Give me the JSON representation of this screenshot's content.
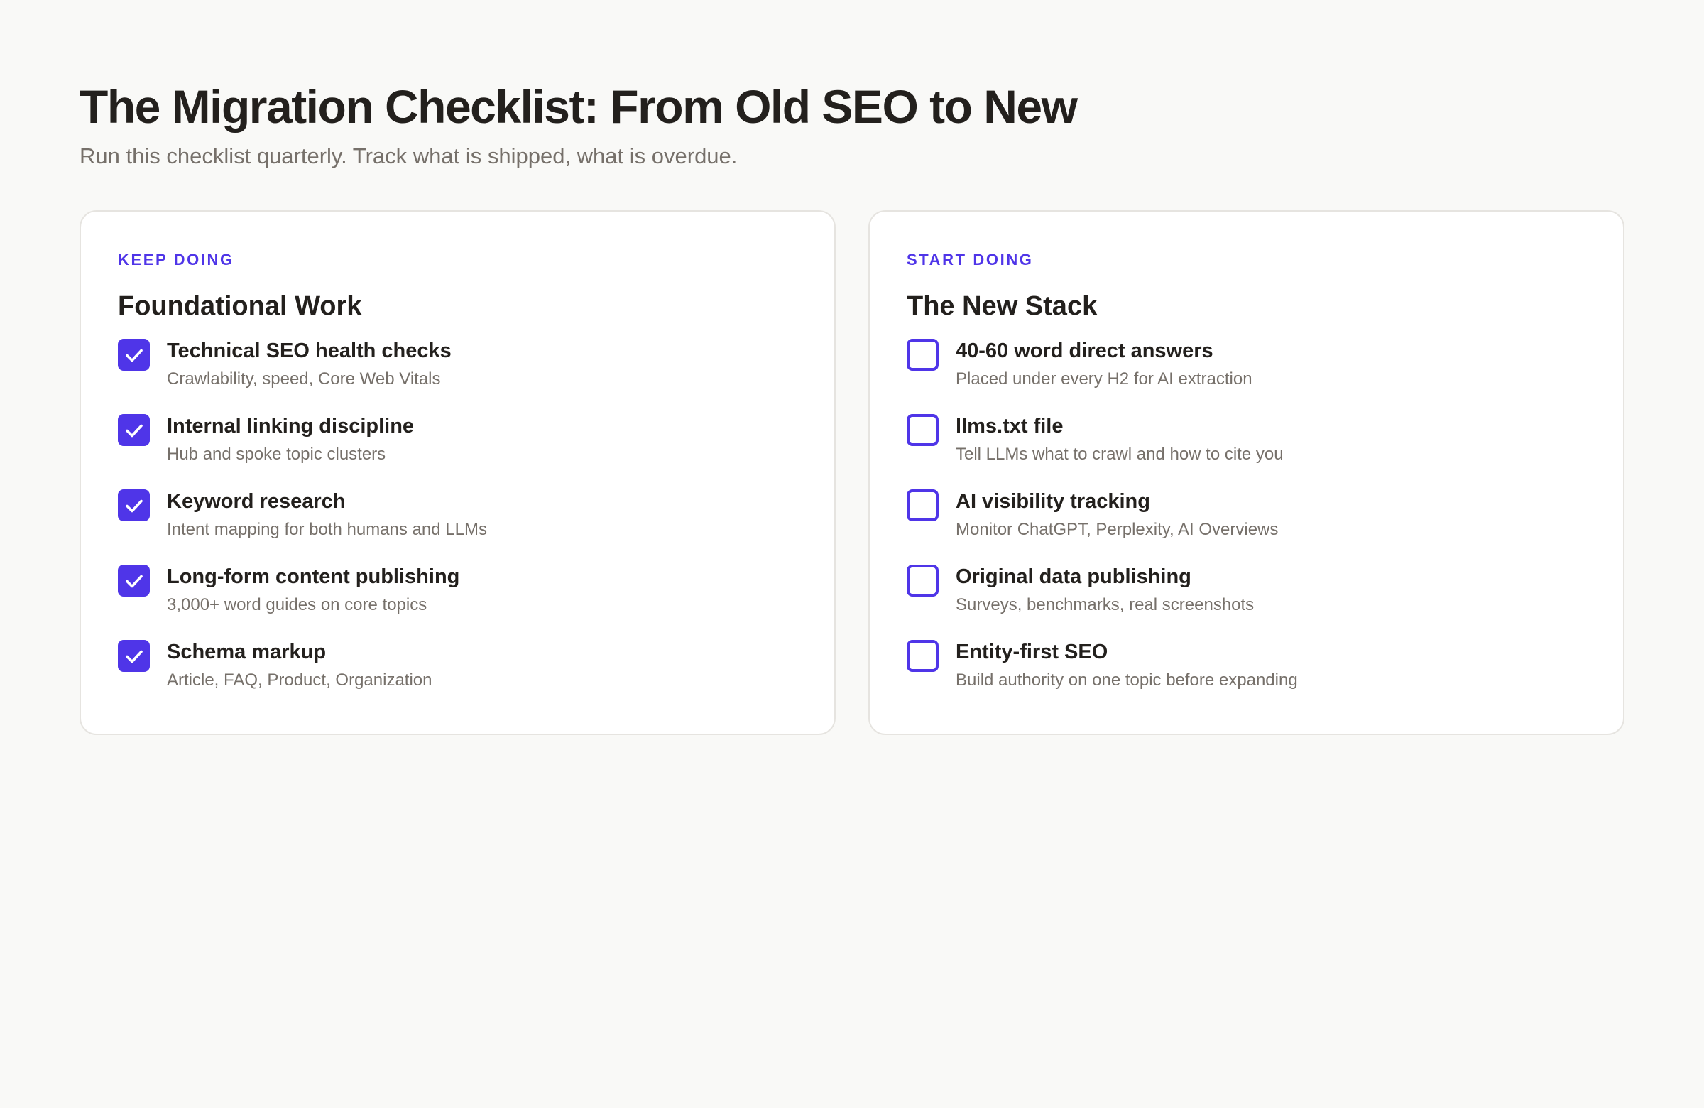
{
  "header": {
    "title": "The Migration Checklist: From Old SEO to New",
    "subtitle": "Run this checklist quarterly. Track what is shipped, what is overdue."
  },
  "colors": {
    "accent": "#4f35e8",
    "background": "#f9f9f7",
    "card": "#ffffff",
    "muted_text": "#76706a"
  },
  "cards": [
    {
      "eyebrow": "KEEP DOING",
      "title": "Foundational Work",
      "items": [
        {
          "title": "Technical SEO health checks",
          "desc": "Crawlability, speed, Core Web Vitals",
          "checked": true,
          "icon": "checkbox-checked-icon"
        },
        {
          "title": "Internal linking discipline",
          "desc": "Hub and spoke topic clusters",
          "checked": true,
          "icon": "checkbox-checked-icon"
        },
        {
          "title": "Keyword research",
          "desc": "Intent mapping for both humans and LLMs",
          "checked": true,
          "icon": "checkbox-checked-icon"
        },
        {
          "title": "Long-form content publishing",
          "desc": "3,000+ word guides on core topics",
          "checked": true,
          "icon": "checkbox-checked-icon"
        },
        {
          "title": "Schema markup",
          "desc": "Article, FAQ, Product, Organization",
          "checked": true,
          "icon": "checkbox-checked-icon"
        }
      ]
    },
    {
      "eyebrow": "START DOING",
      "title": "The New Stack",
      "items": [
        {
          "title": "40-60 word direct answers",
          "desc": "Placed under every H2 for AI extraction",
          "checked": false,
          "icon": "checkbox-empty-icon"
        },
        {
          "title": "llms.txt file",
          "desc": "Tell LLMs what to crawl and how to cite you",
          "checked": false,
          "icon": "checkbox-empty-icon"
        },
        {
          "title": "AI visibility tracking",
          "desc": "Monitor ChatGPT, Perplexity, AI Overviews",
          "checked": false,
          "icon": "checkbox-empty-icon"
        },
        {
          "title": "Original data publishing",
          "desc": "Surveys, benchmarks, real screenshots",
          "checked": false,
          "icon": "checkbox-empty-icon"
        },
        {
          "title": "Entity-first SEO",
          "desc": "Build authority on one topic before expanding",
          "checked": false,
          "icon": "checkbox-empty-icon"
        }
      ]
    }
  ]
}
